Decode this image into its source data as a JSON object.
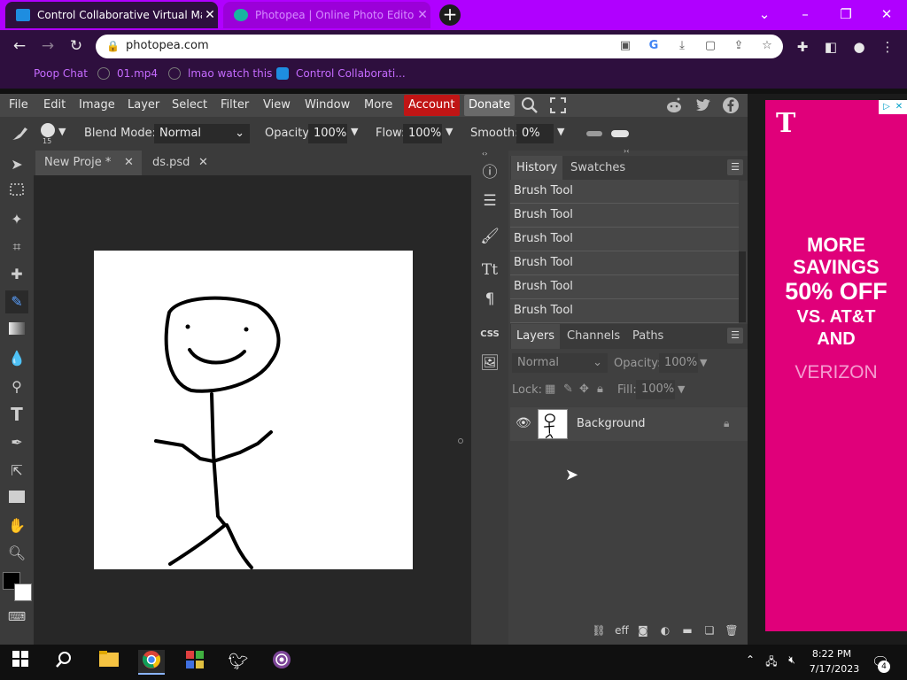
{
  "browser": {
    "tabs": [
      {
        "title": "Control Collaborative Virtual Mac"
      },
      {
        "title": "Photopea | Online Photo Editor"
      }
    ],
    "url": "photopea.com",
    "bookmarks": [
      {
        "label": "Poop Chat"
      },
      {
        "label": "01.mp4"
      },
      {
        "label": "lmao watch this"
      },
      {
        "label": "Control Collaborati..."
      }
    ]
  },
  "menu": {
    "items": [
      "File",
      "Edit",
      "Image",
      "Layer",
      "Select",
      "Filter",
      "View",
      "Window",
      "More"
    ],
    "account": "Account",
    "donate": "Donate"
  },
  "options": {
    "brush_size": "15",
    "blend_label": "Blend Mode:",
    "blend_value": "Normal",
    "opacity_label": "Opacity:",
    "opacity_value": "100%",
    "flow_label": "Flow:",
    "flow_value": "100%",
    "smooth_label": "Smooth:",
    "smooth_value": "0%"
  },
  "documents": [
    {
      "name": "New Proje",
      "modified": "*"
    },
    {
      "name": "ds.psd"
    }
  ],
  "history_panel": {
    "tabs": [
      "History",
      "Swatches"
    ],
    "items": [
      "Brush Tool",
      "Brush Tool",
      "Brush Tool",
      "Brush Tool",
      "Brush Tool",
      "Brush Tool"
    ]
  },
  "layers_panel": {
    "tabs": [
      "Layers",
      "Channels",
      "Paths"
    ],
    "blend": "Normal",
    "opacity_label": "Opacity:",
    "opacity_value": "100%",
    "lock_label": "Lock:",
    "fill_label": "Fill:",
    "fill_value": "100%",
    "layers": [
      {
        "name": "Background",
        "locked": true
      }
    ],
    "footer_eff": "eff"
  },
  "side_panel": {
    "css_label": "CSS"
  },
  "ad": {
    "logo": "T",
    "line1": "MORE",
    "line2": "SAVINGS",
    "line3": "50% OFF",
    "line4": "VS. AT&T",
    "line5": "AND",
    "line6": "VERIZON",
    "brand_color": "#e0007a"
  },
  "taskbar": {
    "time": "8:22 PM",
    "date": "7/17/2023",
    "notifications": "4"
  }
}
